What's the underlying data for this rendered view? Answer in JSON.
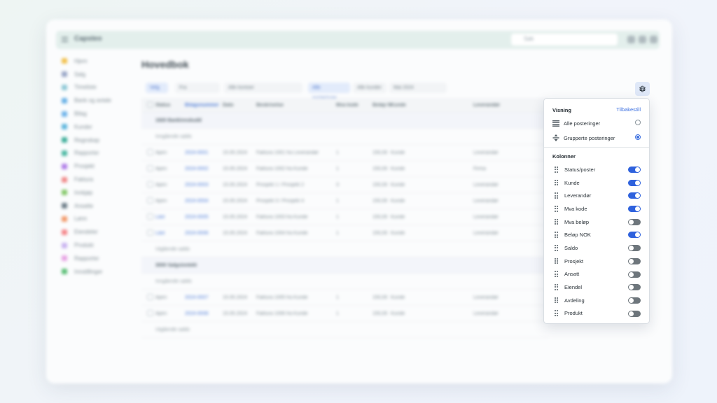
{
  "app": {
    "title": "Capsteo",
    "search_placeholder": "Søk",
    "page_title": "Hovedbok"
  },
  "sidebar": {
    "items": [
      {
        "label": "Hjem",
        "color": "#f2c14e"
      },
      {
        "label": "Salg",
        "color": "#9aa7c7"
      },
      {
        "label": "Timeliste",
        "color": "#8fc9d6"
      },
      {
        "label": "Bank og avtale",
        "color": "#6ab2e6"
      },
      {
        "label": "Bilag",
        "color": "#6fb4ea"
      },
      {
        "label": "Kunder",
        "color": "#5fb6dd"
      },
      {
        "label": "Regnskap",
        "color": "#3fae9b"
      },
      {
        "label": "Rapporter",
        "color": "#4cb8a3"
      },
      {
        "label": "Prosjekt",
        "color": "#b07ee8"
      },
      {
        "label": "Faktura",
        "color": "#f08a8a"
      },
      {
        "label": "Innkjøp",
        "color": "#86c96a"
      },
      {
        "label": "Ansatte",
        "color": "#6f7f8a"
      },
      {
        "label": "Lønn",
        "color": "#f29a6b"
      },
      {
        "label": "Eiendeler",
        "color": "#f5868a"
      },
      {
        "label": "Produkt",
        "color": "#c9b3f0"
      },
      {
        "label": "Rapporter",
        "color": "#e7a3e3"
      },
      {
        "label": "Innstillinger",
        "color": "#5cbf77"
      }
    ]
  },
  "filters": {
    "chip_1": "Velg",
    "chip_2": "Fra",
    "chip_3": "Alle kontoer",
    "chip_4": "Alle posteringer",
    "chip_5": "Alle kunder",
    "chip_6": "Mai 2024"
  },
  "table": {
    "headers": [
      "Status",
      "Bilagsnummer",
      "Dato",
      "Beskrivelse",
      "Mva kode",
      "Beløp NOK",
      "Kunde",
      "Leverandør"
    ],
    "groups": [
      {
        "title": "1920 Bankinnskudd",
        "opening": "Inngående saldo",
        "rows": [
          [
            "Åpen",
            "2024-0001",
            "15.05.2024",
            "Faktura 1001 fra Leverandør",
            "1",
            "150,00",
            "Kunde",
            "Leverandør"
          ],
          [
            "Åpen",
            "2024-0002",
            "15.05.2024",
            "Faktura 1002 fra Kunde",
            "1",
            "150,00",
            "Kunde",
            "Firma"
          ],
          [
            "Åpen",
            "2024-0003",
            "15.05.2024",
            "Prosjekt 1 / Prosjekt 2",
            "3",
            "150,00",
            "Kunde",
            "Leverandør"
          ],
          [
            "Åpen",
            "2024-0004",
            "15.05.2024",
            "Prosjekt 3 / Prosjekt 4",
            "1",
            "150,00",
            "Kunde",
            "Leverandør"
          ],
          [
            "Låst",
            "2024-0005",
            "15.05.2024",
            "Faktura 1003 fra Kunde",
            "1",
            "150,00",
            "Kunde",
            "Leverandør"
          ],
          [
            "Låst",
            "2024-0006",
            "15.05.2024",
            "Faktura 1004 fra Kunde",
            "1",
            "150,00",
            "Kunde",
            "Leverandør"
          ]
        ],
        "closing": "Utgående saldo"
      },
      {
        "title": "3000 Salgsinntekt",
        "opening": "Inngående saldo",
        "rows": [
          [
            "Åpen",
            "2024-0007",
            "15.05.2024",
            "Faktura 1005 fra Kunde",
            "1",
            "150,00",
            "Kunde",
            "Leverandør"
          ],
          [
            "Åpen",
            "2024-0008",
            "15.05.2024",
            "Faktura 1006 fra Kunde",
            "1",
            "150,00",
            "Kunde",
            "Leverandør"
          ]
        ],
        "closing": "Utgående saldo"
      }
    ]
  },
  "settings_panel": {
    "view_title": "Visning",
    "reset_label": "Tilbakestill",
    "view_options": [
      {
        "label": "Alle posteringer",
        "icon": "list-icon",
        "selected": false
      },
      {
        "label": "Grupperte posteringer",
        "icon": "group-icon",
        "selected": true
      }
    ],
    "columns_title": "Kolonner",
    "columns": [
      {
        "label": "Status/poster",
        "enabled": true
      },
      {
        "label": "Kunde",
        "enabled": true
      },
      {
        "label": "Leverandør",
        "enabled": true
      },
      {
        "label": "Mva kode",
        "enabled": true
      },
      {
        "label": "Mva beløp",
        "enabled": false
      },
      {
        "label": "Beløp NOK",
        "enabled": true
      },
      {
        "label": "Saldo",
        "enabled": false
      },
      {
        "label": "Prosjekt",
        "enabled": false
      },
      {
        "label": "Ansatt",
        "enabled": false
      },
      {
        "label": "Eiendel",
        "enabled": false
      },
      {
        "label": "Avdeling",
        "enabled": false
      },
      {
        "label": "Produkt",
        "enabled": false
      }
    ],
    "accent_color": "#2f62dd",
    "toggle_off_color": "#6e767c"
  }
}
